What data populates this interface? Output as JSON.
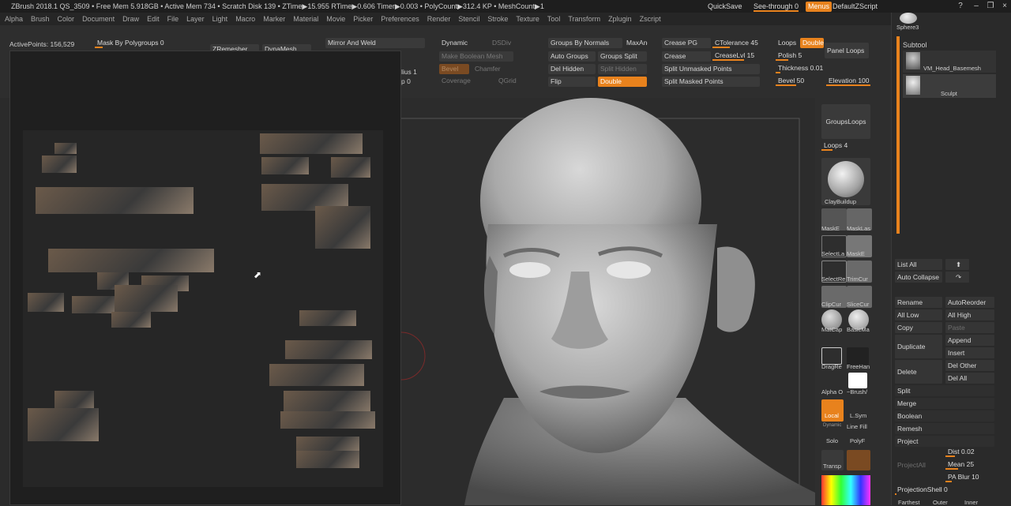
{
  "titlebar": {
    "title": "ZBrush 2018.1   QS_3509   • Free Mem 5.918GB • Active Mem 734 • Scratch Disk 139 • ZTime▶15.955 RTime▶0.606 Timer▶0.003 • PolyCount▶312.4 KP • MeshCount▶1",
    "quicksave": "QuickSave",
    "seethrough": "See-through  0",
    "menus": "Menus",
    "script": "DefaultZScript"
  },
  "menubar": [
    "Alpha",
    "Brush",
    "Color",
    "Document",
    "Draw",
    "Edit",
    "File",
    "Layer",
    "Light",
    "Macro",
    "Marker",
    "Material",
    "Movie",
    "Picker",
    "Preferences",
    "Render",
    "Stencil",
    "Stroke",
    "Texture",
    "Tool",
    "Transform",
    "Zplugin",
    "Zscript"
  ],
  "shelf": {
    "active_points": "ActivePoints: 156,529",
    "mask_by_polygroups": "Mask By Polygroups 0",
    "zremesher": "ZRemesher",
    "dynamesh": "DynaMesh",
    "mirror_and_weld": "Mirror And Weld",
    "dynamic": "Dynamic",
    "dsdiv": "DSDiv",
    "make_boolean_mesh": "Make Boolean Mesh",
    "bevel": "Bevel",
    "chamfer": "Chamfer",
    "coverage": "Coverage",
    "qgrid": "QGrid",
    "radius": "lius 1",
    "loop": "p 0",
    "groups_by_normals": "Groups By Normals",
    "maxang": "MaxAng",
    "auto_groups": "Auto Groups",
    "groups_split": "Groups Split",
    "del_hidden": "Del Hidden",
    "split_hidden": "Split Hidden",
    "flip": "Flip",
    "double": "Double",
    "crease_pg": "Crease PG",
    "ctolerance": "CTolerance 45",
    "crease": "Crease",
    "creaselvl": "CreaseLvl 15",
    "split_unmasked": "Split Unmasked Points",
    "split_masked": "Split Masked Points",
    "loops": "Loops",
    "double2": "Double",
    "panel_loops": "Panel Loops",
    "polish": "Polish 5",
    "thickness": "Thickness 0.01",
    "bevel_val": "Bevel 50",
    "elevation": "Elevation 100"
  },
  "right_shelf": {
    "groups_loops": "GroupsLoops",
    "loops4": "Loops 4",
    "clay_buildup": "ClayBuildup",
    "maske": "MaskE",
    "masklas": "MaskLas",
    "selectla": "SelectLa",
    "selectre": "SelectRe",
    "selectrect": "SelectRe",
    "trimcur": "TrimCur",
    "clipcur": "ClipCur",
    "slicecur": "SliceCur",
    "matcap": "MatCap",
    "basicma": "BasicMa",
    "dragrect": "DragRe",
    "freehand": "FreeHan",
    "alpha_off": "Alpha O",
    "brush_alpha": "~Brush/",
    "local": "Local",
    "lsym": "L.Sym",
    "dynamic": "Dynamic",
    "solo": "Solo",
    "line_fill": "Line Fill",
    "polyf": "PolyF",
    "transp": "Transp"
  },
  "tray": {
    "sphere": "Sphere3",
    "subtool_title": "Subtool",
    "subtools": [
      {
        "name": "VM_Head_Basemesh"
      },
      {
        "name": "Sculpt"
      }
    ],
    "list_all": "List All",
    "auto_collapse": "Auto Collapse",
    "rename": "Rename",
    "autoreorder": "AutoReorder",
    "all_low": "All Low",
    "all_high": "All High",
    "copy": "Copy",
    "paste": "Paste",
    "duplicate": "Duplicate",
    "append": "Append",
    "insert": "Insert",
    "delete": "Delete",
    "del_other": "Del Other",
    "del_all": "Del All",
    "split": "Split",
    "merge": "Merge",
    "boolean": "Boolean",
    "remesh": "Remesh",
    "project": "Project",
    "project_all": "ProjectAll",
    "dist": "Dist 0.02",
    "mean": "Mean 25",
    "pa_blur": "PA Blur 10",
    "projection_shell": "ProjectionShell 0",
    "farthest": "Farthest",
    "outer": "Outer",
    "inner": "Inner"
  },
  "colors": {
    "accent": "#e8821d",
    "panel": "#2e2e2e",
    "titlebar": "#1e1e1e"
  }
}
